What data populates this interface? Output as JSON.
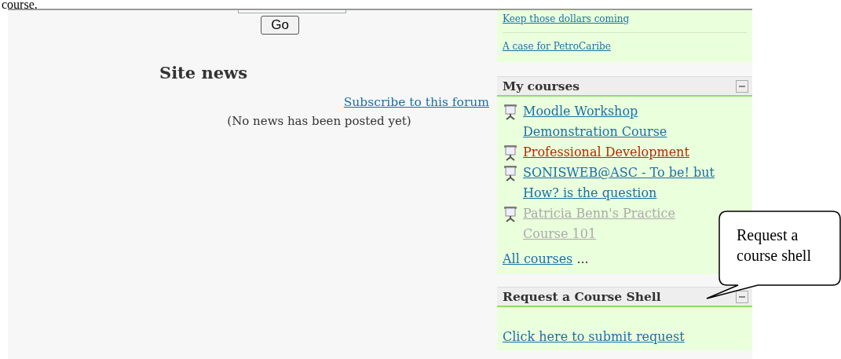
{
  "document_text": "course.",
  "search": {
    "button": "Go"
  },
  "site_news": {
    "title": "Site news",
    "subscribe_link": "Subscribe to this forum",
    "empty_message": "(No news has been posted yet)"
  },
  "news_block": {
    "links": [
      "Keep those dollars coming",
      "A case for PetroCaribe"
    ]
  },
  "my_courses": {
    "title": "My courses",
    "courses": [
      {
        "name": "Moodle Workshop Demonstration Course",
        "highlighted": false,
        "dimmed": false
      },
      {
        "name": "Professional Development",
        "highlighted": true,
        "dimmed": false
      },
      {
        "name": "SONISWEB@ASC - To be! but How? is the question",
        "highlighted": false,
        "dimmed": false
      },
      {
        "name": "Patricia Benn's Practice Course 101",
        "highlighted": false,
        "dimmed": true
      }
    ],
    "all_link": "All courses",
    "ellipsis": "..."
  },
  "request_block": {
    "title": "Request a Course Shell",
    "link": "Click here to submit request"
  },
  "callout": {
    "text": "Request a course shell"
  }
}
